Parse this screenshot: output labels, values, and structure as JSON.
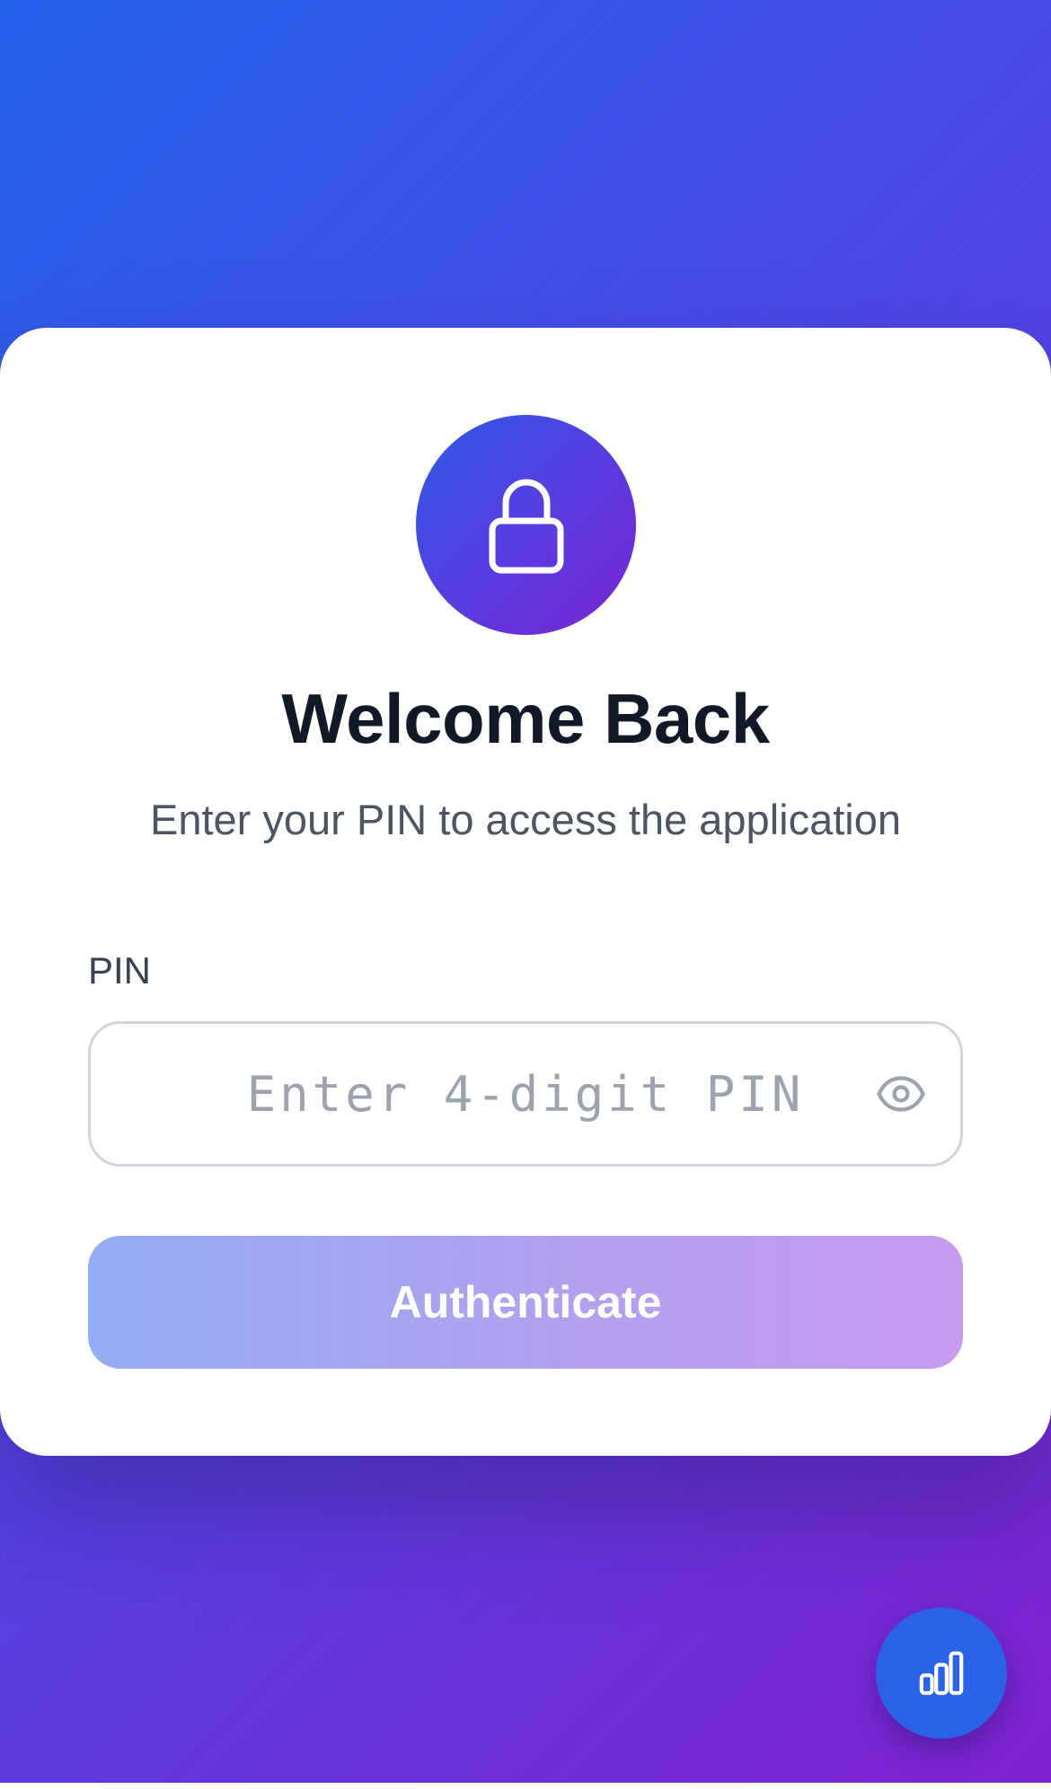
{
  "login": {
    "icon": "lock-icon",
    "title": "Welcome Back",
    "subtitle": "Enter your PIN to access the application",
    "pin_label": "PIN",
    "pin_value": "",
    "pin_placeholder": "Enter 4-digit PIN",
    "toggle_icon": "eye-icon",
    "submit_label": "Authenticate"
  },
  "fab": {
    "icon": "bar-chart-icon"
  },
  "colors": {
    "gradient_start": "#2563eb",
    "gradient_mid": "#4f46e5",
    "gradient_end": "#7e22ce",
    "title": "#111827",
    "subtitle": "#4b5563",
    "placeholder": "#9ca3af",
    "input_border": "#d1d5db",
    "fab": "#2b63e6"
  }
}
